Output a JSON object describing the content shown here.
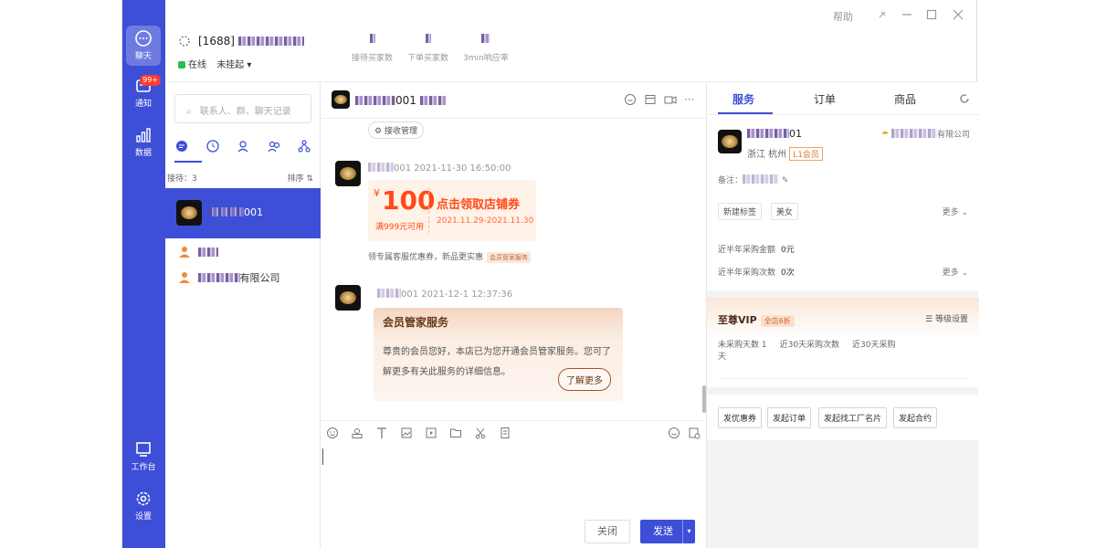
{
  "rail": {
    "chat_label": "聊天",
    "notify_label": "通知",
    "notify_badge": "99+",
    "data_label": "数据",
    "workbench_label": "工作台",
    "settings_label": "设置"
  },
  "header": {
    "shop_prefix": "[1688]",
    "online_status": "在线",
    "hangup_label": "未挂起",
    "stats": [
      {
        "label": "接待买家数"
      },
      {
        "label": "下单买家数"
      },
      {
        "label": "3min响应率"
      }
    ],
    "help_label": "帮助"
  },
  "contacts": {
    "search_placeholder": "联系人、群、聊天记录",
    "waiting_label": "接待：3",
    "sort_label": "排序 ⇅",
    "items": [
      {
        "name_suffix": "001",
        "active": true
      },
      {
        "name_suffix": ""
      },
      {
        "name_suffix": "有限公司"
      }
    ]
  },
  "chat": {
    "title_suffix": "001",
    "receive_mgmt": "接收管理",
    "msg1_meta": "001   2021-11-30 16:50:00",
    "coupon": {
      "currency": "¥",
      "amount": "100",
      "condition": "满999元可用",
      "title": "点击领取店铺券",
      "dates": "2021.11.29-2021.11.30"
    },
    "coupon_note": "领专属客服优惠券，新品更实惠",
    "coupon_tag": "会员管家服务",
    "msg2_meta": "001   2021-12-1 12:37:36",
    "vip_card": {
      "title": "会员管家服务",
      "body": "尊贵的会员您好，本店已为您开通会员管家服务。您可了解更多有关此服务的详细信息。",
      "more": "了解更多"
    },
    "close_label": "关闭",
    "send_label": "发送"
  },
  "right": {
    "tabs": [
      "服务",
      "订单",
      "商品"
    ],
    "buyer_suffix": "01",
    "location": "浙江 杭州",
    "level": "L1会员",
    "company": "有限公司",
    "note_label": "备注：",
    "tag_new": "新建标签",
    "tag_beauty": "美女",
    "more": "更多",
    "purchase_amount_label": "近半年采购金额",
    "purchase_amount": "0元",
    "purchase_count_label": "近半年采购次数",
    "purchase_count": "0次",
    "vip_title": "至尊VIP",
    "vip_discount": "全店6折",
    "level_setting": "等级设置",
    "stat_not_purchased": "未采购天数 1",
    "stat_30_count": "近30天采购次数",
    "stat_30_amount": "近30天采购",
    "stat_day_unit": "天",
    "actions": [
      "发优惠券",
      "发起订单",
      "发起找工厂名片",
      "发起合约"
    ]
  }
}
